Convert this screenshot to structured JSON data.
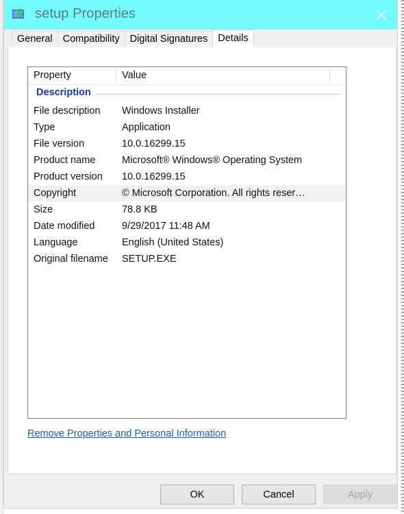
{
  "window": {
    "title": "setup Properties",
    "icon": "installer-icon",
    "close_label": "✕",
    "titlebar_color": "#73fbfd"
  },
  "tabs": [
    {
      "label": "General",
      "active": false
    },
    {
      "label": "Compatibility",
      "active": false
    },
    {
      "label": "Digital Signatures",
      "active": false
    },
    {
      "label": "Details",
      "active": true
    }
  ],
  "details": {
    "columns": {
      "property": "Property",
      "value": "Value"
    },
    "section": "Description",
    "rows": [
      {
        "name": "File description",
        "value": "Windows Installer",
        "highlighted": false
      },
      {
        "name": "Type",
        "value": "Application",
        "highlighted": false
      },
      {
        "name": "File version",
        "value": "10.0.16299.15",
        "highlighted": false
      },
      {
        "name": "Product name",
        "value": "Microsoft® Windows® Operating System",
        "highlighted": false
      },
      {
        "name": "Product version",
        "value": "10.0.16299.15",
        "highlighted": false
      },
      {
        "name": "Copyright",
        "value": "© Microsoft Corporation. All rights reser…",
        "highlighted": true
      },
      {
        "name": "Size",
        "value": "78.8 KB",
        "highlighted": false
      },
      {
        "name": "Date modified",
        "value": "9/29/2017 11:48 AM",
        "highlighted": false
      },
      {
        "name": "Language",
        "value": "English (United States)",
        "highlighted": false
      },
      {
        "name": "Original filename",
        "value": "SETUP.EXE",
        "highlighted": false
      }
    ],
    "remove_link": "Remove Properties and Personal Information"
  },
  "footer": {
    "ok": "OK",
    "cancel": "Cancel",
    "apply": "Apply",
    "apply_enabled": false
  }
}
